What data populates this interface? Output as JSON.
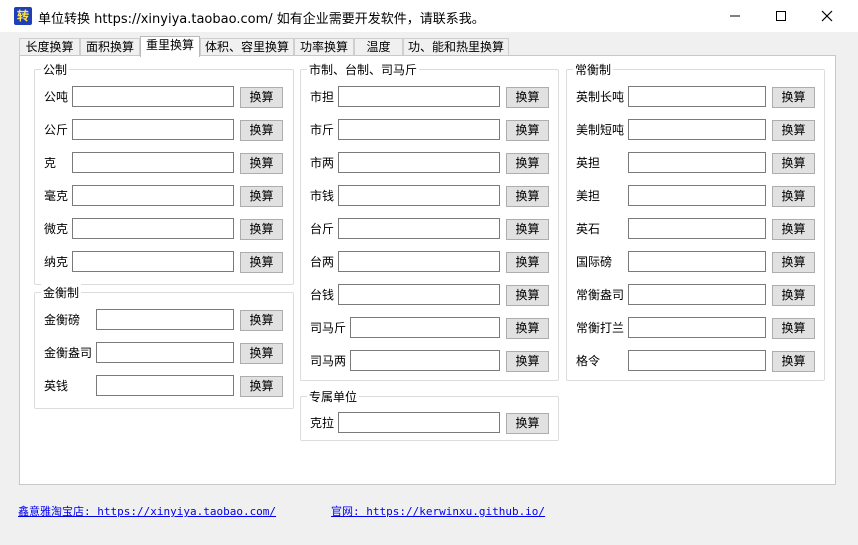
{
  "window": {
    "title": "单位转换 https://xinyiya.taobao.com/  如有企业需要开发软件，请联系我。",
    "app_icon_text": "转",
    "min_icon": "minimize-icon",
    "max_icon": "maximize-icon",
    "close_icon": "close-icon"
  },
  "tabs": [
    {
      "label": "长度换算",
      "active": false
    },
    {
      "label": "面积换算",
      "active": false
    },
    {
      "label": "重里换算",
      "active": true
    },
    {
      "label": "体积、容里换算",
      "active": false
    },
    {
      "label": "功率换算",
      "active": false
    },
    {
      "label": "温度",
      "active": false
    },
    {
      "label": "功、能和热里换算",
      "active": false
    }
  ],
  "groups": {
    "metric": {
      "title": "公制",
      "rows": [
        "公吨",
        "公斤",
        "克",
        "毫克",
        "微克",
        "纳克"
      ]
    },
    "gold": {
      "title": "金衡制",
      "rows": [
        "金衡磅",
        "金衡盎司",
        "英钱"
      ]
    },
    "chinese": {
      "title": "市制、台制、司马斤",
      "rows": [
        "市担",
        "市斤",
        "市两",
        "市钱",
        "台斤",
        "台两",
        "台钱",
        "司马斤",
        "司马两"
      ]
    },
    "special": {
      "title": "专属单位",
      "rows": [
        "克拉"
      ]
    },
    "avoirdupois": {
      "title": "常衡制",
      "rows": [
        "英制长吨",
        "美制短吨",
        "英担",
        "美担",
        "英石",
        "国际磅",
        "常衡盎司",
        "常衡打兰",
        "格令"
      ]
    }
  },
  "convert_label": "换算",
  "footer": {
    "shop_link": "鑫意雅淘宝店: https://xinyiya.taobao.com/",
    "site_link": "官网: https://kerwinxu.github.io/"
  }
}
